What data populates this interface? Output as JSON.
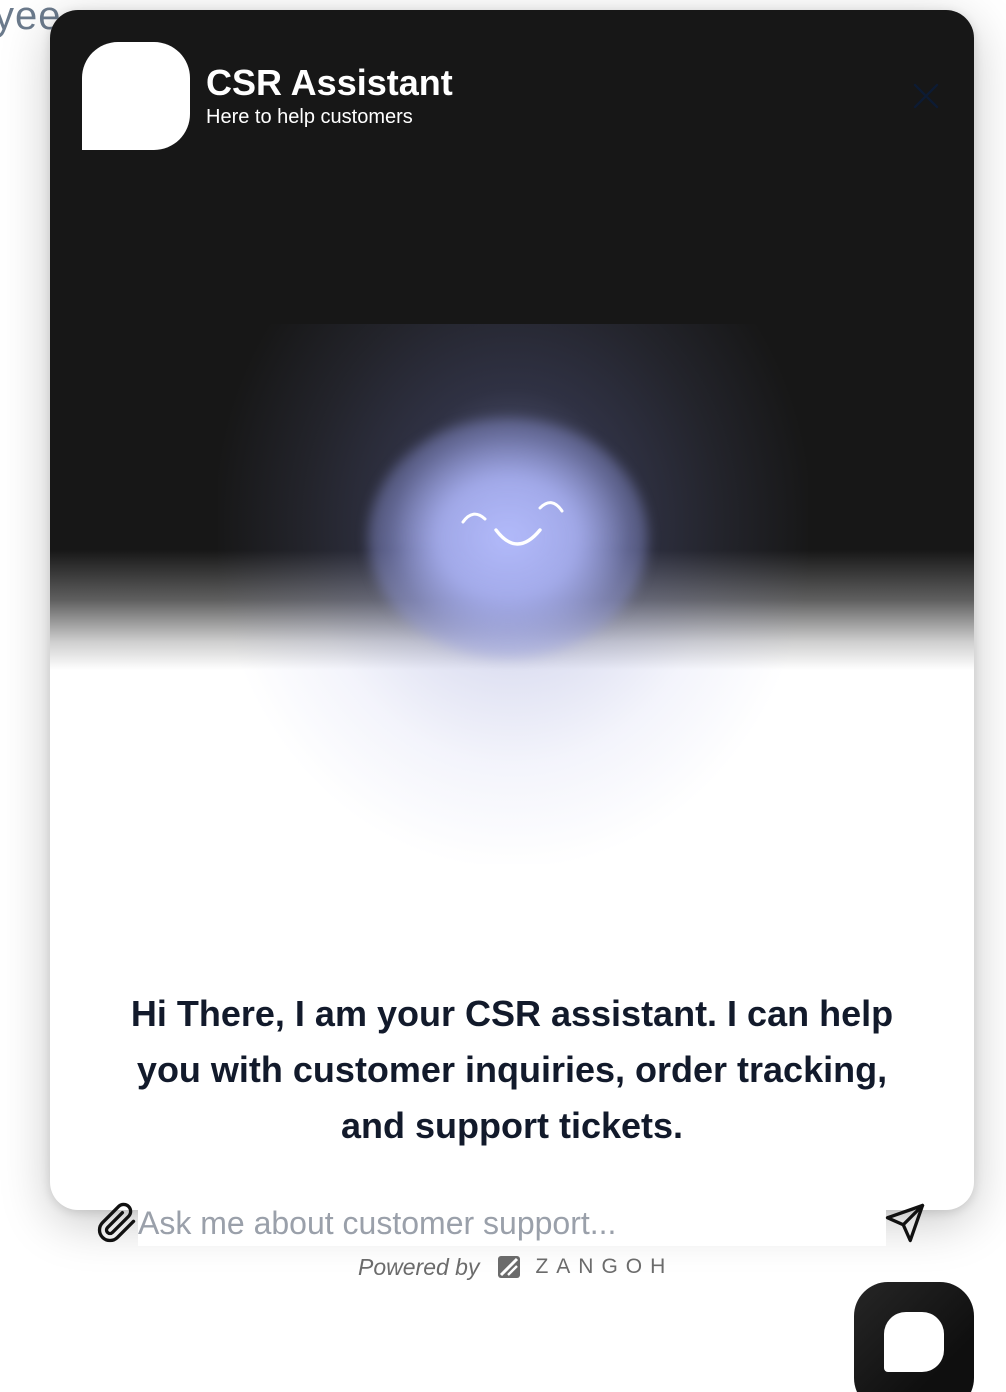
{
  "background": {
    "text_fragment": "yee"
  },
  "header": {
    "title": "CSR Assistant",
    "subtitle": "Here to help customers",
    "close_icon": "close-icon"
  },
  "greeting": {
    "message": "Hi There, I am your CSR assistant. I can help you with customer inquiries, order tracking, and support tickets."
  },
  "composer": {
    "value": "",
    "placeholder": "Ask me about customer support...",
    "attach_icon": "paperclip-icon",
    "send_icon": "send-icon"
  },
  "footer": {
    "powered_by": "Powered by",
    "brand": "ZANGOH"
  },
  "launcher": {
    "icon": "chat-bubble-icon"
  },
  "colors": {
    "header_bg": "#171717",
    "glow": "#b2baf9",
    "text_dark": "#121a2b",
    "placeholder": "#9aa0aa",
    "muted": "#6b6b6b"
  }
}
